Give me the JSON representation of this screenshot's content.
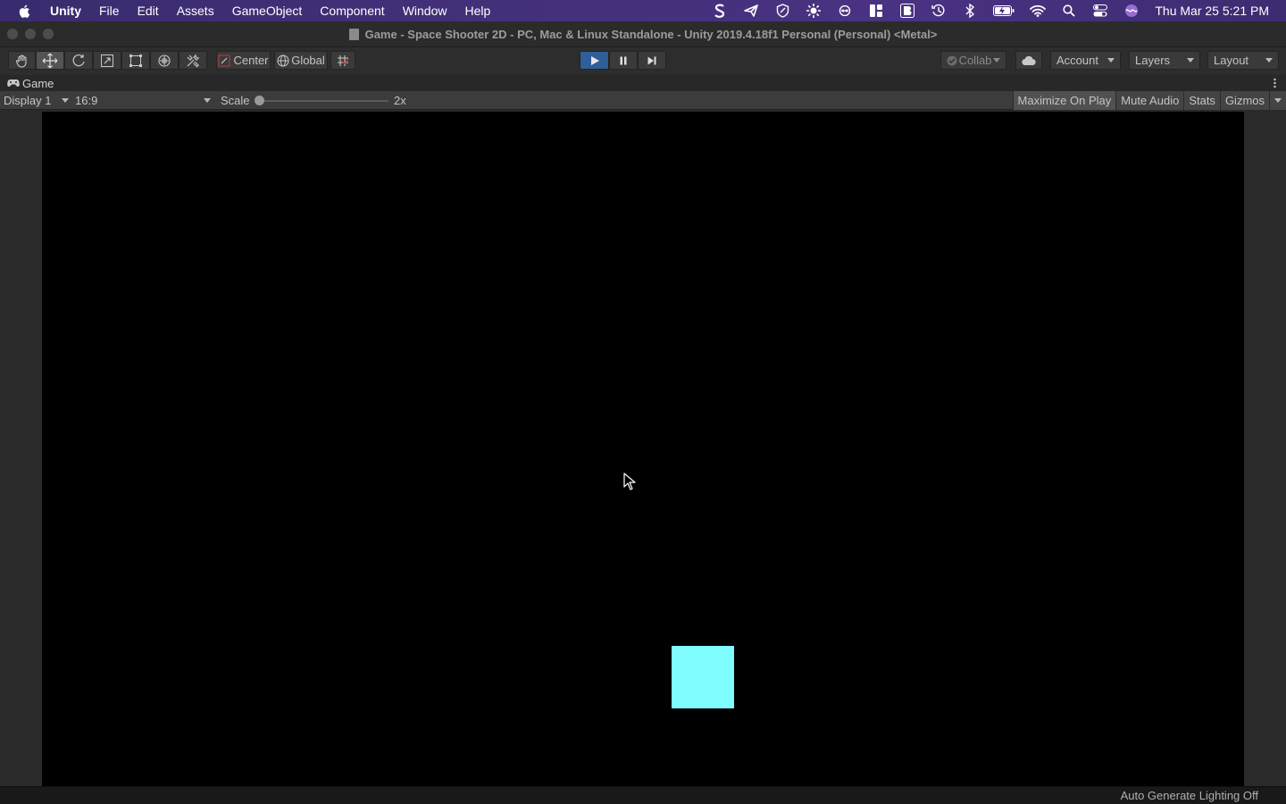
{
  "menubar": {
    "app_name": "Unity",
    "items": [
      "File",
      "Edit",
      "Assets",
      "GameObject",
      "Component",
      "Window",
      "Help"
    ],
    "status_icons": [
      "scrivener-icon",
      "paper-plane-icon",
      "vpn-shield-icon",
      "brightness-icon",
      "infinity-icon",
      "layout-grid-icon",
      "bold-b-icon",
      "time-machine-icon",
      "bluetooth-icon",
      "battery-charging-icon",
      "wifi-icon",
      "spotlight-search-icon",
      "control-center-icon",
      "siri-icon"
    ],
    "datetime": "Thu Mar 25  5:21 PM"
  },
  "window": {
    "title": "Game - Space Shooter 2D - PC, Mac & Linux Standalone - Unity 2019.4.18f1 Personal (Personal) <Metal>"
  },
  "toolbar": {
    "tools": [
      "hand-tool",
      "move-tool",
      "rotate-tool",
      "scale-tool",
      "rect-tool",
      "transform-tool",
      "custom-tool"
    ],
    "selected_tool": "move-tool",
    "pivot_label": "Center",
    "space_label": "Global",
    "collab_label": "Collab",
    "account_label": "Account",
    "layers_label": "Layers",
    "layout_label": "Layout"
  },
  "game_view": {
    "tab_label": "Game",
    "display_label": "Display 1",
    "aspect_label": "16:9",
    "scale_label": "Scale",
    "scale_value": "2x",
    "scale_level": 0.0,
    "maximize_label": "Maximize On Play",
    "mute_label": "Mute Audio",
    "stats_label": "Stats",
    "gizmos_label": "Gizmos",
    "player_color": "#80fdff"
  },
  "statusbar": {
    "text": "Auto Generate Lighting Off"
  },
  "colors": {
    "menubar_accent": "#43307a",
    "play_active": "#2f5f99",
    "editor_bg": "#282828"
  }
}
